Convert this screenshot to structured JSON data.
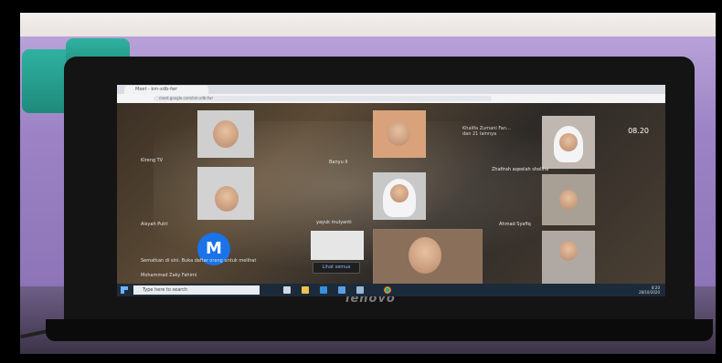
{
  "scene": {
    "brand_logo": "lenovo",
    "colors": {
      "border": "#000000",
      "tablecloth": "#9c83c5",
      "chair": "#2fb2a0",
      "meet_avatar": "#1a73e8",
      "taskbar": "#1c2b3a"
    }
  },
  "browser": {
    "tab_title": "Meet - km-xdb-fwr",
    "address": "meet.google.com/km-xdb-fwr"
  },
  "meet": {
    "clock": "08.20",
    "info_text": "Khalifa Zumani Fan... dan 21 lainnya",
    "participants": [
      {
        "name": "Kireng TV"
      },
      {
        "name": "Banyu II"
      },
      {
        "name": "Zhafirah aqeelah sholiha"
      },
      {
        "name": "Aisyah Putri"
      },
      {
        "name": "yayuk mulyanti"
      },
      {
        "name": "Ahmad Syafiq"
      }
    ],
    "avatar_letter": "M",
    "side_panel_text": "Sematkan di sini. Buka daftar orang untuk melihat",
    "self_name": "Mohammad Zaky Fahimi",
    "see_all_label": "Lihat semua"
  },
  "taskbar": {
    "search_placeholder": "Type here to search",
    "time": "8:20",
    "date": "28/10/2020"
  }
}
